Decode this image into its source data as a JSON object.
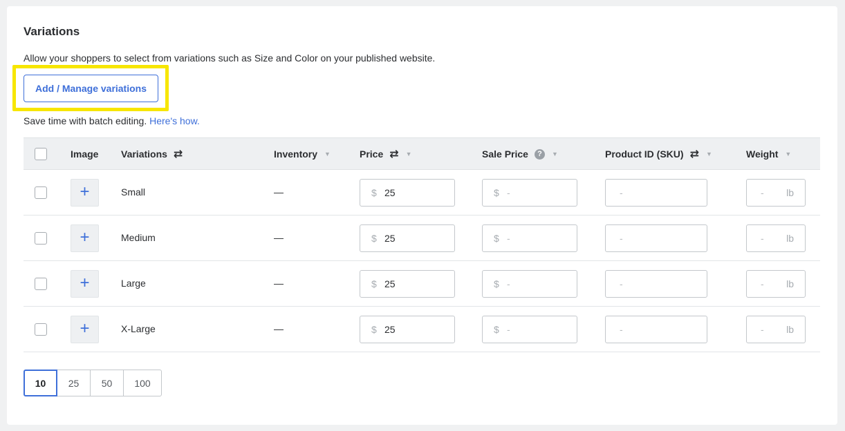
{
  "section": {
    "title": "Variations",
    "description": "Allow your shoppers to select from variations such as Size and Color on your published website.",
    "manage_button": "Add / Manage variations",
    "batch_text": "Save time with batch editing.",
    "batch_link": "Here's how."
  },
  "table": {
    "headers": {
      "image": "Image",
      "variations": "Variations",
      "inventory": "Inventory",
      "price": "Price",
      "sale_price": "Sale Price",
      "sku": "Product ID (SKU)",
      "weight": "Weight"
    },
    "help_glyph": "?",
    "sort_glyph": "⇄",
    "caret_glyph": "▼",
    "add_image_glyph": "+",
    "currency_symbol": "$",
    "placeholder": "-",
    "weight_unit": "lb",
    "rows": [
      {
        "name": "Small",
        "inventory": "—",
        "price": "25"
      },
      {
        "name": "Medium",
        "inventory": "—",
        "price": "25"
      },
      {
        "name": "Large",
        "inventory": "—",
        "price": "25"
      },
      {
        "name": "X-Large",
        "inventory": "—",
        "price": "25"
      }
    ]
  },
  "pagination": {
    "options": [
      "10",
      "25",
      "50",
      "100"
    ],
    "selected": "10"
  },
  "colors": {
    "accent": "#3e6fd9",
    "highlight": "#f7e600"
  }
}
